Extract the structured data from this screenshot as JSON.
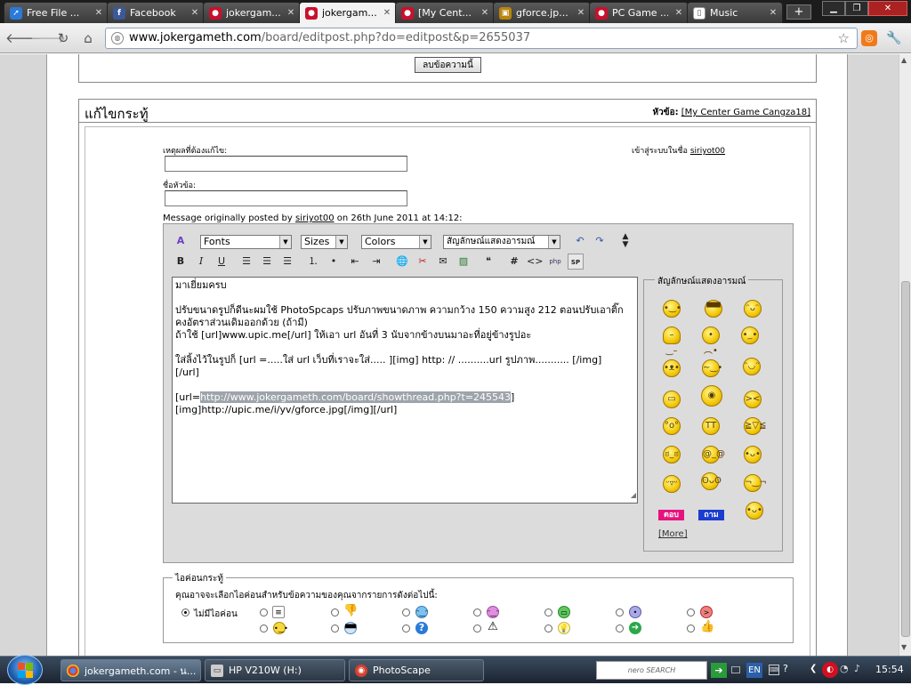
{
  "browser": {
    "tabs": [
      {
        "label": "Free File ...",
        "icon": "arrow-icon",
        "color": "#2a7ad8"
      },
      {
        "label": "Facebook",
        "icon": "facebook-icon",
        "color": "#3b5998"
      },
      {
        "label": "jokergam...",
        "icon": "joker-icon",
        "color": "#c8102e"
      },
      {
        "label": "jokergam...",
        "icon": "joker-icon",
        "color": "#c8102e"
      },
      {
        "label": "[My Cent...",
        "icon": "joker-icon",
        "color": "#c8102e"
      },
      {
        "label": "gforce.jp...",
        "icon": "image-icon",
        "color": "#b8860b"
      },
      {
        "label": "PC Game ...",
        "icon": "joker-icon",
        "color": "#c8102e"
      },
      {
        "label": "Music",
        "icon": "page-icon",
        "color": "#ffffff"
      }
    ],
    "url_host": "www.jokergameth.com",
    "url_path": "/board/editpost.php?do=editpost&p=2655037"
  },
  "top_panel": {
    "delete_button": "ลบข้อความนี้"
  },
  "edit_panel": {
    "title": "แก้ไขกระทู้",
    "thread_label": "หัวข้อ:",
    "thread_name": "[My Center Game Cangza18]",
    "reason_label": "เหตุผลที่ต้องแก้ไข:",
    "subject_label": "ชื่อหัวข้อ:",
    "logged_in_label": "เข้าสู่ระบบในชื่อ",
    "username": "siriyot00",
    "message_prefix": "Message originally posted by",
    "message_user": "siriyot00",
    "message_suffix": "on 26th June 2011 at 14:12:"
  },
  "editor": {
    "fonts": "Fonts",
    "sizes": "Sizes",
    "colors": "Colors",
    "smilies_select": "สัญลักษณ์แสดงอารมณ์",
    "text": {
      "line1": "มาเยี่ยมครบ",
      "line2": "ปรับขนาดรูปก็ดีนะผมใช้ PhotoSpcaps ปรับภาพขนาดภาพ ความกว้าง 150 ความสูง 212 ตอนปรับเอาติ๊ก",
      "line3": "คงอัตราส่วนเดิมออกด้วย (ถ้ามี)",
      "line4": "ถ้าใช้ [url]www.upic.me[/url] ให้เอา url อันที่ 3 นับจากข้างบนมาอะที่อยู่ข้างรูปอะ",
      "line5": "ใส่ลิ้งไว้ในรูปก็ [url =.....ใส่ url เว็บที่เราจะใส่..... ][img] http: // ..........url รูปภาพ........... [/img]",
      "line6": "[/url]",
      "line7_prefix": "[url=",
      "line7_link": "http://www.jokergameth.com/board/showthread.php?t=245543",
      "line7_suffix": "]",
      "line8": "[img]http://upic.me/i/yv/gforce.jpg[/img][/url]"
    },
    "smilies_title": "สัญลักษณ์แสดงอารมณ์",
    "tag_answer": "ตอบ",
    "tag_ask": "ถาม",
    "more": "[More]"
  },
  "post_icons": {
    "title": "ไอค่อนกระทู้",
    "desc": "คุณอาจจะเลือกไอค่อนสำหรับข้อความของคุณจากรายการดังต่อไปนี้:",
    "no_icon": "ไม่มีไอค่อน"
  },
  "taskbar": {
    "items": [
      "jokergameth.com - น...",
      "HP V210W (H:)",
      "PhotoScape"
    ],
    "search": "nero SEARCH",
    "lang": "EN",
    "clock": "15:54"
  }
}
